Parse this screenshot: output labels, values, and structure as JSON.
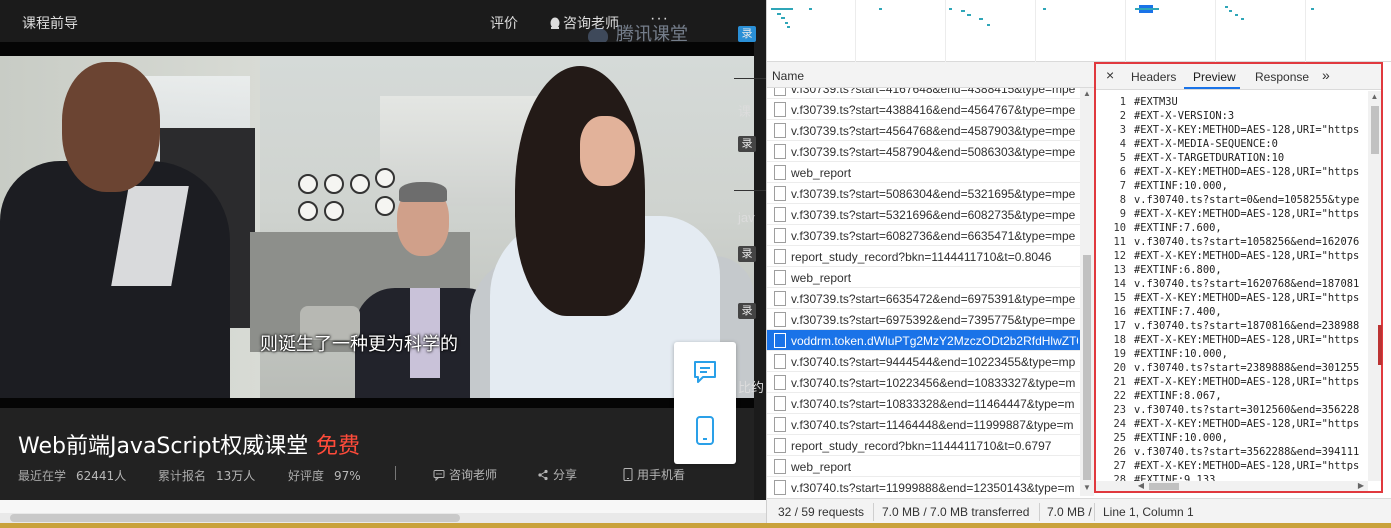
{
  "course": {
    "topbar": {
      "title": "课程前导",
      "rate": "评价",
      "consult": "咨询老师",
      "dots": "···",
      "logo": "腾讯课堂"
    },
    "subtitle": "则诞生了一种更为科学的",
    "name": "Web前端JavaScript权威课堂",
    "free": "免费",
    "stats": {
      "learning_label": "最近在学",
      "learning_value": "62441人",
      "enrolled_label": "累计报名",
      "enrolled_value": "13万人",
      "rating_label": "好评度",
      "rating_value": "97%"
    },
    "actions": {
      "consult": "咨询老师",
      "share": "分享",
      "mobile": "用手机看"
    },
    "side": {
      "tag1": "录",
      "text1": "课",
      "tag2": "录",
      "text2": "jav",
      "tag3": "录",
      "tag4": "录",
      "text3": "比约"
    }
  },
  "devtools": {
    "name_header": "Name",
    "requests": [
      "v.f30739.ts?start=4167648&end=4388415&type=mpe",
      "v.f30739.ts?start=4388416&end=4564767&type=mpe",
      "v.f30739.ts?start=4564768&end=4587903&type=mpe",
      "v.f30739.ts?start=4587904&end=5086303&type=mpe",
      "web_report",
      "v.f30739.ts?start=5086304&end=5321695&type=mpe",
      "v.f30739.ts?start=5321696&end=6082735&type=mpe",
      "v.f30739.ts?start=6082736&end=6635471&type=mpe",
      "report_study_record?bkn=1144411710&t=0.8046",
      "web_report",
      "v.f30739.ts?start=6635472&end=6975391&type=mpe",
      "v.f30739.ts?start=6975392&end=7395775&type=mpe",
      "voddrm.token.dWluPTg2MzY2MzczODt2b2RfdHlwZT0",
      "v.f30740.ts?start=9444544&end=10223455&type=mp",
      "v.f30740.ts?start=10223456&end=10833327&type=m",
      "v.f30740.ts?start=10833328&end=11464447&type=m",
      "v.f30740.ts?start=11464448&end=11999887&type=m",
      "report_study_record?bkn=1144411710&t=0.6797",
      "web_report",
      "v.f30740.ts?start=11999888&end=12350143&type=m"
    ],
    "selected_index": 12,
    "status": {
      "requests": "32 / 59 requests",
      "transferred": "7.0 MB / 7.0 MB transferred",
      "resources": "7.0 MB /"
    },
    "preview": {
      "close": "×",
      "tabs": [
        "Headers",
        "Preview",
        "Response"
      ],
      "more": "»",
      "active_tab": "Preview",
      "lines": [
        "#EXTM3U",
        "#EXT-X-VERSION:3",
        "#EXT-X-KEY:METHOD=AES-128,URI=\"https",
        "#EXT-X-MEDIA-SEQUENCE:0",
        "#EXT-X-TARGETDURATION:10",
        "#EXT-X-KEY:METHOD=AES-128,URI=\"https",
        "#EXTINF:10.000,",
        "v.f30740.ts?start=0&end=1058255&type",
        "#EXT-X-KEY:METHOD=AES-128,URI=\"https",
        "#EXTINF:7.600,",
        "v.f30740.ts?start=1058256&end=162076",
        "#EXT-X-KEY:METHOD=AES-128,URI=\"https",
        "#EXTINF:6.800,",
        "v.f30740.ts?start=1620768&end=187081",
        "#EXT-X-KEY:METHOD=AES-128,URI=\"https",
        "#EXTINF:7.400,",
        "v.f30740.ts?start=1870816&end=238988",
        "#EXT-X-KEY:METHOD=AES-128,URI=\"https",
        "#EXTINF:10.000,",
        "v.f30740.ts?start=2389888&end=301255",
        "#EXT-X-KEY:METHOD=AES-128,URI=\"https",
        "#EXTINF:8.067,",
        "v.f30740.ts?start=3012560&end=356228",
        "#EXT-X-KEY:METHOD=AES-128,URI=\"https",
        "#EXTINF:10.000,",
        "v.f30740.ts?start=3562288&end=394111",
        "#EXT-X-KEY:METHOD=AES-128,URI=\"https",
        "#EXTINF:9.133,",
        ""
      ],
      "cursor": "Line 1, Column 1"
    }
  },
  "colors": {
    "accent": "#1a73e8",
    "highlight_border": "#e0393e",
    "free_red": "#ff4b3a",
    "side_tag": "#2a8fd6"
  }
}
